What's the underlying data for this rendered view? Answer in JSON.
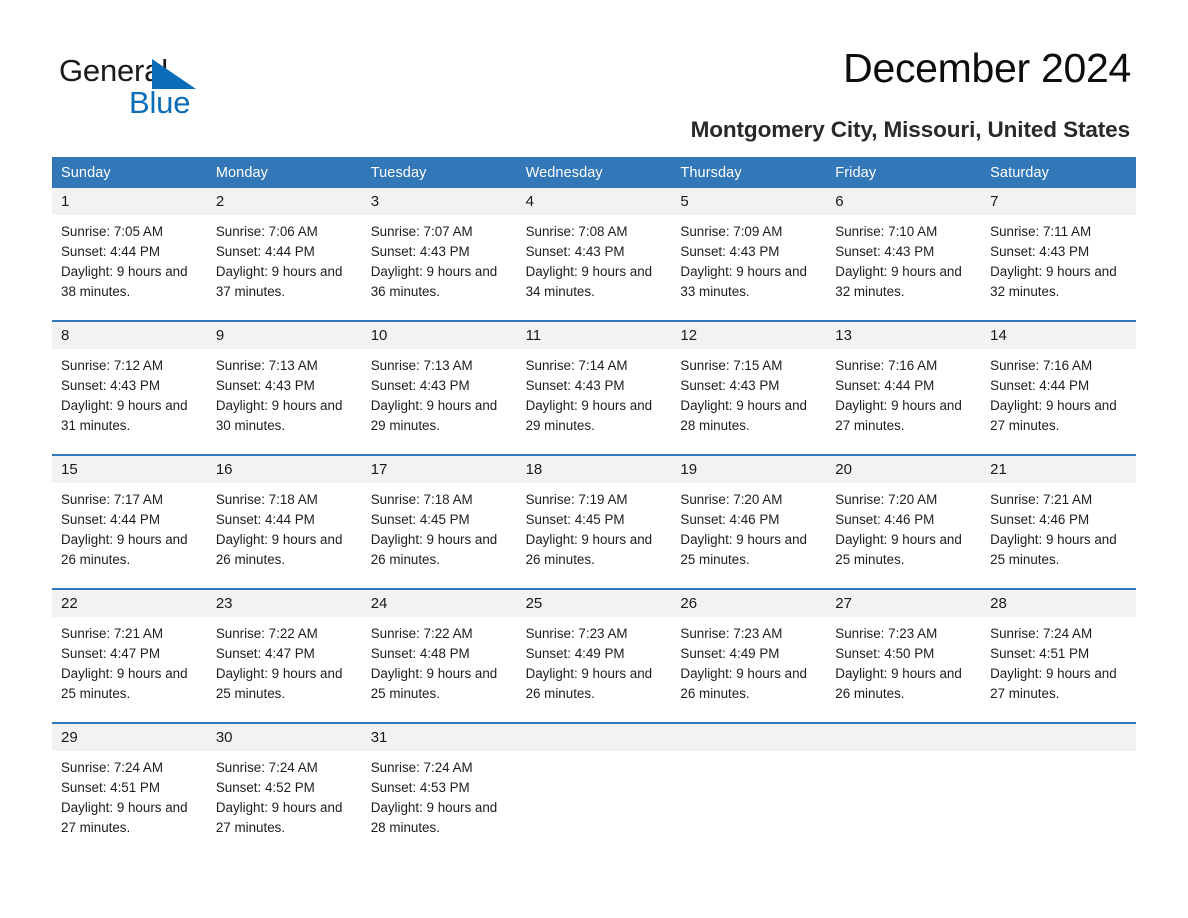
{
  "brand": {
    "name_part1": "General",
    "name_part2": "Blue",
    "triangle_color": "#0b6cb7",
    "accent_color": "#3277b8"
  },
  "header": {
    "month_title": "December 2024",
    "location": "Montgomery City, Missouri, United States"
  },
  "calendar": {
    "day_headers": [
      "Sunday",
      "Monday",
      "Tuesday",
      "Wednesday",
      "Thursday",
      "Friday",
      "Saturday"
    ],
    "header_bg": "#3277b8",
    "daynum_bg": "#f2f2f2",
    "weeks": [
      {
        "days": [
          {
            "num": "1",
            "sunrise": "Sunrise: 7:05 AM",
            "sunset": "Sunset: 4:44 PM",
            "daylight": "Daylight: 9 hours and 38 minutes."
          },
          {
            "num": "2",
            "sunrise": "Sunrise: 7:06 AM",
            "sunset": "Sunset: 4:44 PM",
            "daylight": "Daylight: 9 hours and 37 minutes."
          },
          {
            "num": "3",
            "sunrise": "Sunrise: 7:07 AM",
            "sunset": "Sunset: 4:43 PM",
            "daylight": "Daylight: 9 hours and 36 minutes."
          },
          {
            "num": "4",
            "sunrise": "Sunrise: 7:08 AM",
            "sunset": "Sunset: 4:43 PM",
            "daylight": "Daylight: 9 hours and 34 minutes."
          },
          {
            "num": "5",
            "sunrise": "Sunrise: 7:09 AM",
            "sunset": "Sunset: 4:43 PM",
            "daylight": "Daylight: 9 hours and 33 minutes."
          },
          {
            "num": "6",
            "sunrise": "Sunrise: 7:10 AM",
            "sunset": "Sunset: 4:43 PM",
            "daylight": "Daylight: 9 hours and 32 minutes."
          },
          {
            "num": "7",
            "sunrise": "Sunrise: 7:11 AM",
            "sunset": "Sunset: 4:43 PM",
            "daylight": "Daylight: 9 hours and 32 minutes."
          }
        ]
      },
      {
        "days": [
          {
            "num": "8",
            "sunrise": "Sunrise: 7:12 AM",
            "sunset": "Sunset: 4:43 PM",
            "daylight": "Daylight: 9 hours and 31 minutes."
          },
          {
            "num": "9",
            "sunrise": "Sunrise: 7:13 AM",
            "sunset": "Sunset: 4:43 PM",
            "daylight": "Daylight: 9 hours and 30 minutes."
          },
          {
            "num": "10",
            "sunrise": "Sunrise: 7:13 AM",
            "sunset": "Sunset: 4:43 PM",
            "daylight": "Daylight: 9 hours and 29 minutes."
          },
          {
            "num": "11",
            "sunrise": "Sunrise: 7:14 AM",
            "sunset": "Sunset: 4:43 PM",
            "daylight": "Daylight: 9 hours and 29 minutes."
          },
          {
            "num": "12",
            "sunrise": "Sunrise: 7:15 AM",
            "sunset": "Sunset: 4:43 PM",
            "daylight": "Daylight: 9 hours and 28 minutes."
          },
          {
            "num": "13",
            "sunrise": "Sunrise: 7:16 AM",
            "sunset": "Sunset: 4:44 PM",
            "daylight": "Daylight: 9 hours and 27 minutes."
          },
          {
            "num": "14",
            "sunrise": "Sunrise: 7:16 AM",
            "sunset": "Sunset: 4:44 PM",
            "daylight": "Daylight: 9 hours and 27 minutes."
          }
        ]
      },
      {
        "days": [
          {
            "num": "15",
            "sunrise": "Sunrise: 7:17 AM",
            "sunset": "Sunset: 4:44 PM",
            "daylight": "Daylight: 9 hours and 26 minutes."
          },
          {
            "num": "16",
            "sunrise": "Sunrise: 7:18 AM",
            "sunset": "Sunset: 4:44 PM",
            "daylight": "Daylight: 9 hours and 26 minutes."
          },
          {
            "num": "17",
            "sunrise": "Sunrise: 7:18 AM",
            "sunset": "Sunset: 4:45 PM",
            "daylight": "Daylight: 9 hours and 26 minutes."
          },
          {
            "num": "18",
            "sunrise": "Sunrise: 7:19 AM",
            "sunset": "Sunset: 4:45 PM",
            "daylight": "Daylight: 9 hours and 26 minutes."
          },
          {
            "num": "19",
            "sunrise": "Sunrise: 7:20 AM",
            "sunset": "Sunset: 4:46 PM",
            "daylight": "Daylight: 9 hours and 25 minutes."
          },
          {
            "num": "20",
            "sunrise": "Sunrise: 7:20 AM",
            "sunset": "Sunset: 4:46 PM",
            "daylight": "Daylight: 9 hours and 25 minutes."
          },
          {
            "num": "21",
            "sunrise": "Sunrise: 7:21 AM",
            "sunset": "Sunset: 4:46 PM",
            "daylight": "Daylight: 9 hours and 25 minutes."
          }
        ]
      },
      {
        "days": [
          {
            "num": "22",
            "sunrise": "Sunrise: 7:21 AM",
            "sunset": "Sunset: 4:47 PM",
            "daylight": "Daylight: 9 hours and 25 minutes."
          },
          {
            "num": "23",
            "sunrise": "Sunrise: 7:22 AM",
            "sunset": "Sunset: 4:47 PM",
            "daylight": "Daylight: 9 hours and 25 minutes."
          },
          {
            "num": "24",
            "sunrise": "Sunrise: 7:22 AM",
            "sunset": "Sunset: 4:48 PM",
            "daylight": "Daylight: 9 hours and 25 minutes."
          },
          {
            "num": "25",
            "sunrise": "Sunrise: 7:23 AM",
            "sunset": "Sunset: 4:49 PM",
            "daylight": "Daylight: 9 hours and 26 minutes."
          },
          {
            "num": "26",
            "sunrise": "Sunrise: 7:23 AM",
            "sunset": "Sunset: 4:49 PM",
            "daylight": "Daylight: 9 hours and 26 minutes."
          },
          {
            "num": "27",
            "sunrise": "Sunrise: 7:23 AM",
            "sunset": "Sunset: 4:50 PM",
            "daylight": "Daylight: 9 hours and 26 minutes."
          },
          {
            "num": "28",
            "sunrise": "Sunrise: 7:24 AM",
            "sunset": "Sunset: 4:51 PM",
            "daylight": "Daylight: 9 hours and 27 minutes."
          }
        ]
      },
      {
        "days": [
          {
            "num": "29",
            "sunrise": "Sunrise: 7:24 AM",
            "sunset": "Sunset: 4:51 PM",
            "daylight": "Daylight: 9 hours and 27 minutes."
          },
          {
            "num": "30",
            "sunrise": "Sunrise: 7:24 AM",
            "sunset": "Sunset: 4:52 PM",
            "daylight": "Daylight: 9 hours and 27 minutes."
          },
          {
            "num": "31",
            "sunrise": "Sunrise: 7:24 AM",
            "sunset": "Sunset: 4:53 PM",
            "daylight": "Daylight: 9 hours and 28 minutes."
          },
          {
            "num": "",
            "sunrise": "",
            "sunset": "",
            "daylight": ""
          },
          {
            "num": "",
            "sunrise": "",
            "sunset": "",
            "daylight": ""
          },
          {
            "num": "",
            "sunrise": "",
            "sunset": "",
            "daylight": ""
          },
          {
            "num": "",
            "sunrise": "",
            "sunset": "",
            "daylight": ""
          }
        ]
      }
    ]
  }
}
